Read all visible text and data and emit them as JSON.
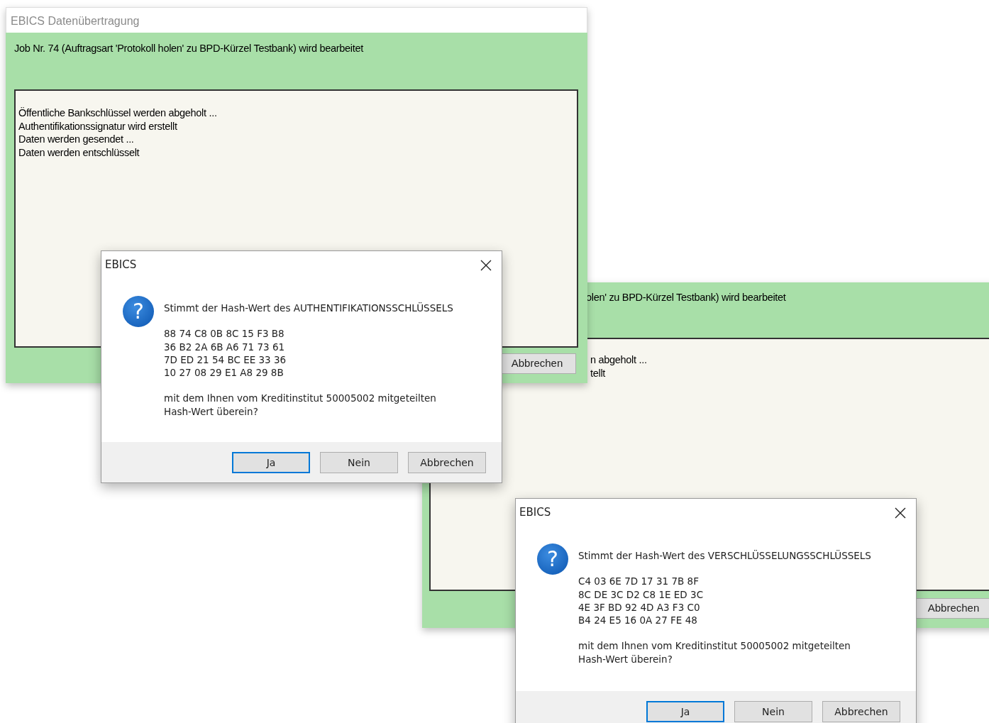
{
  "windows": [
    {
      "title": "EBICS Datenübertragung",
      "status": "Job Nr. 74 (Auftragsart 'Protokoll holen' zu BPD-Kürzel Testbank) wird bearbeitet",
      "log": [
        "Öffentliche Bankschlüssel werden abgeholt ...",
        "Authentifikationssignatur wird erstellt",
        "Daten werden gesendet ...",
        "Daten werden entschlüsselt"
      ],
      "buttons": [
        "Abbrechen"
      ]
    },
    {
      "status": "olen' zu BPD-Kürzel Testbank) wird bearbeitet",
      "log": [
        "n abgeholt ...",
        "tellt"
      ],
      "buttons": [
        "Abbrechen"
      ]
    }
  ],
  "dialogs": [
    {
      "title": "EBICS",
      "icon": "?",
      "question": "Stimmt der Hash-Wert des AUTHENTIFIKATIONSSCHLÜSSELS",
      "hash_lines": [
        "88 74 C8 0B 8C 15 F3 B8",
        "36 B2 2A 6B A6 71 73 61",
        "7D ED 21 54 BC EE 33 36",
        "10 27 08 29 E1 A8 29 8B"
      ],
      "closing": "mit dem Ihnen vom Kreditinstitut 50005002 mitgeteilten\nHash-Wert überein?",
      "buttons": [
        {
          "label": "Ja",
          "default": true
        },
        {
          "label": "Nein",
          "default": false
        },
        {
          "label": "Abbrechen",
          "default": false
        }
      ]
    },
    {
      "title": "EBICS",
      "icon": "?",
      "question": "Stimmt der Hash-Wert des VERSCHLÜSSELUNGSSCHLÜSSELS",
      "hash_lines": [
        "C4 03 6E 7D 17 31 7B 8F",
        "8C DE 3C D2 C8 1E ED 3C",
        "4E 3F BD 92 4D A3 F3 C0",
        "B4 24 E5 16 0A 27 FE 48"
      ],
      "closing": "mit dem Ihnen vom Kreditinstitut 50005002 mitgeteilten\nHash-Wert überein?",
      "buttons": [
        {
          "label": "Ja",
          "default": true
        },
        {
          "label": "Nein",
          "default": false
        },
        {
          "label": "Abbrechen",
          "default": false
        }
      ]
    }
  ]
}
